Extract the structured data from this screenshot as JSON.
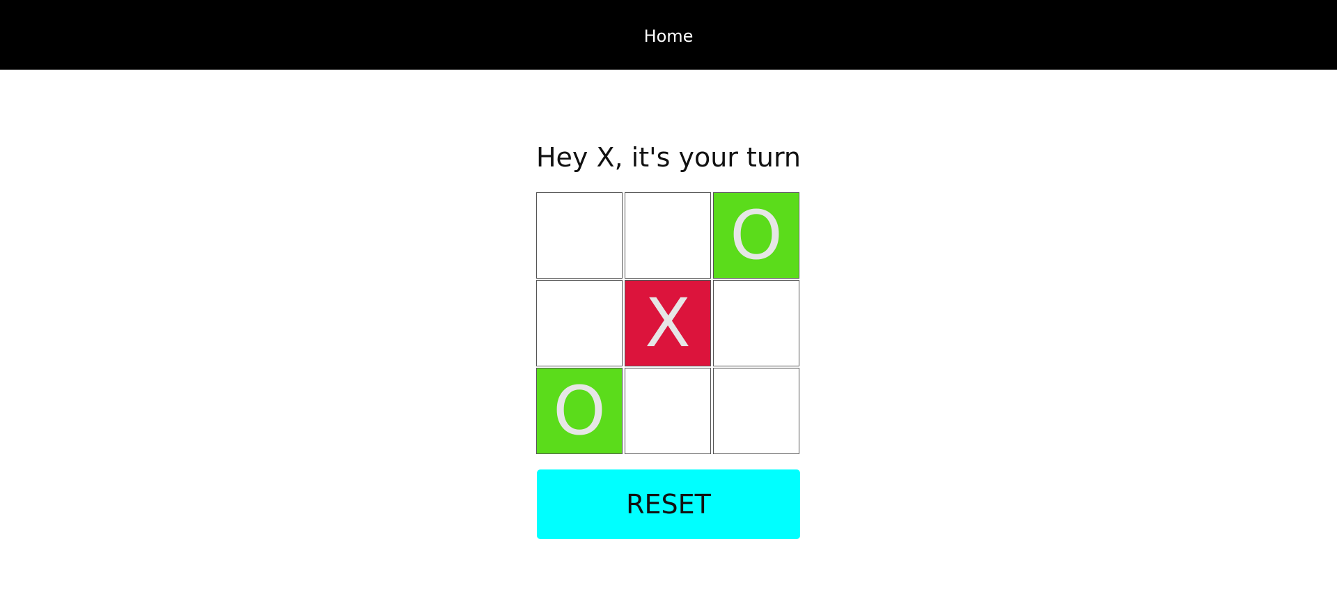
{
  "nav": {
    "home_label": "Home"
  },
  "game": {
    "status_text": "Hey X, it's your turn",
    "board": [
      [
        "",
        "",
        "O"
      ],
      [
        "",
        "X",
        ""
      ],
      [
        "O",
        "",
        ""
      ]
    ],
    "colors": {
      "X": "#dc143c",
      "O": "#5bdc1b",
      "empty": "#ffffff",
      "mark": "#e6e6e6"
    }
  },
  "reset": {
    "label": "RESET",
    "color": "#00ffff"
  }
}
